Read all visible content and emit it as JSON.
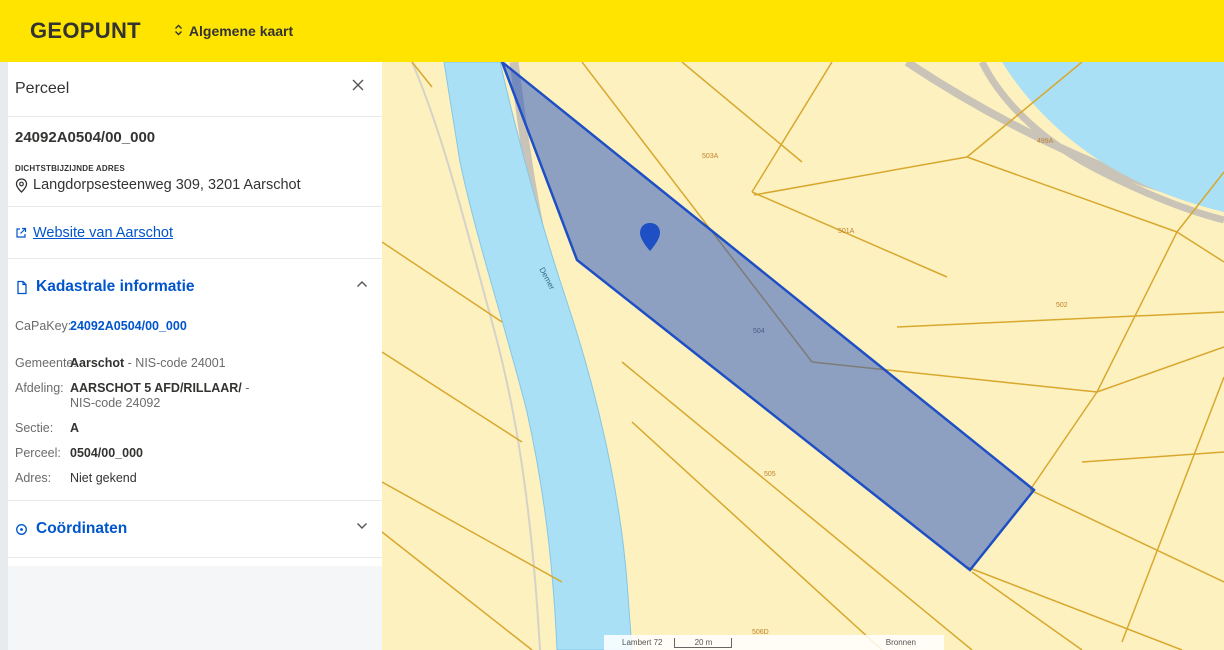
{
  "header": {
    "brand": "GEOPUNT",
    "map_selector": "Algemene kaart"
  },
  "panel": {
    "title": "Perceel",
    "parcel_id": "24092A0504/00_000",
    "address_label": "DICHTSTBIJZIJNDE ADRES",
    "address": "Langdorpsesteenweg 309, 3201 Aarschot",
    "website_link": "Website van Aarschot",
    "cadastral": {
      "title": "Kadastrale informatie",
      "capakey_label": "CaPaKey:",
      "capakey_value": "24092A0504/00_000",
      "municipality_label": "Gemeente:",
      "municipality_name": "Aarschot",
      "municipality_nis": " - NIS-code 24001",
      "division_label": "Afdeling:",
      "division_name": "AARSCHOT 5 AFD/RILLAAR/",
      "division_dash": " -",
      "division_nis": "NIS-code 24092",
      "section_label": "Sectie:",
      "section_value": "A",
      "parcel_label": "Perceel:",
      "parcel_value": "0504/00_000",
      "address_label": "Adres:",
      "address_value": "Niet gekend"
    },
    "coordinates_title": "Coördinaten"
  },
  "map": {
    "parcel_labels": [
      "503A",
      "499A",
      "501A",
      "502",
      "504",
      "505",
      "506D"
    ],
    "river_label": "Demer",
    "scale": {
      "projection": "Lambert 72",
      "distance": "20 m",
      "sources": "Bronnen"
    }
  },
  "colors": {
    "header": "#ffe400",
    "link": "#0055cc",
    "parcel_fill": "#fdf1bf",
    "parcel_line": "#d8a82e",
    "water": "#a9e0f5",
    "selection": "#1f4fc4"
  }
}
